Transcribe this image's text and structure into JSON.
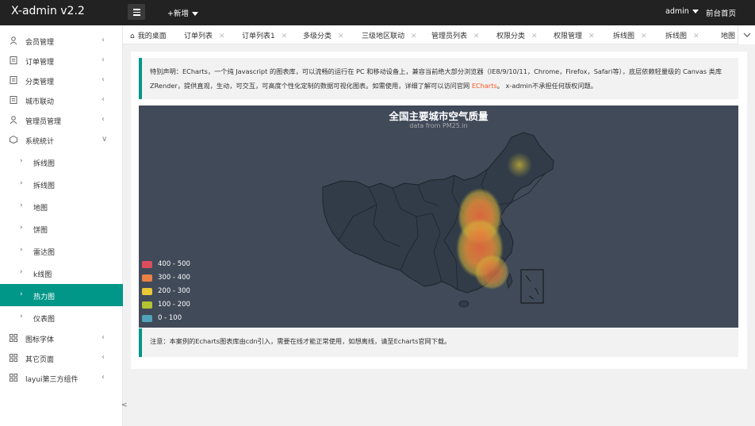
{
  "app": {
    "title": "X-admin v2.2"
  },
  "header": {
    "add_label": "+新增",
    "user_label": "admin",
    "front_label": "前台首页"
  },
  "sidebar": {
    "items": [
      {
        "label": "会员管理",
        "icon": "user-icon"
      },
      {
        "label": "订单管理",
        "icon": "doc-icon"
      },
      {
        "label": "分类管理",
        "icon": "doc-icon"
      },
      {
        "label": "城市联动",
        "icon": "doc-icon"
      },
      {
        "label": "管理员管理",
        "icon": "user-icon"
      },
      {
        "label": "系统统计",
        "icon": "stats-icon"
      }
    ],
    "sub_items": [
      {
        "label": "拆线图"
      },
      {
        "label": "拆线图"
      },
      {
        "label": "地图"
      },
      {
        "label": "饼图"
      },
      {
        "label": "雷达图"
      },
      {
        "label": "k线图"
      },
      {
        "label": "热力图",
        "active": true
      },
      {
        "label": "仪表图"
      }
    ],
    "bottom_items": [
      {
        "label": "图标字体",
        "icon": "grid-icon"
      },
      {
        "label": "其它页面",
        "icon": "grid-icon"
      },
      {
        "label": "layui第三方组件",
        "icon": "grid-icon"
      }
    ]
  },
  "tabs": [
    {
      "label": "我的桌面",
      "home": true
    },
    {
      "label": "订单列表"
    },
    {
      "label": "订单列表1"
    },
    {
      "label": "多级分类"
    },
    {
      "label": "三级地区联动"
    },
    {
      "label": "管理员列表"
    },
    {
      "label": "权限分类"
    },
    {
      "label": "权限管理"
    },
    {
      "label": "拆线图"
    },
    {
      "label": "拆线图"
    },
    {
      "label": "地图"
    }
  ],
  "notice": {
    "text_before": "特别声明：ECharts，一个纯 Javascript 的图表库，可以流畅的运行在 PC 和移动设备上，兼容当前绝大部分浏览器（IE8/9/10/11，Chrome，Firefox，Safari等），底层依赖轻量级的 Canvas 类库 ZRender，提供直观，生动，可交互，可高度个性化定制的数据可视化图表。如需使用，详细了解可以访问官网",
    "link": "ECharts",
    "text_after": "。 x-admin不承担任何版权问题。"
  },
  "chart_data": {
    "type": "heatmap",
    "title": "全国主要城市空气质量",
    "subtitle": "data from PM25.in",
    "background": "#404a59",
    "legend": [
      {
        "label": "400 - 500",
        "color": "#d94e5d"
      },
      {
        "label": "300 - 400",
        "color": "#eb8146"
      },
      {
        "label": "200 - 300",
        "color": "#eac736"
      },
      {
        "label": "100 - 200",
        "color": "#b5c334"
      },
      {
        "label": "0 - 100",
        "color": "#50a3ba"
      }
    ]
  },
  "footer_notice": {
    "text": "注意：本案例的Echarts图表库由cdn引入，需要在线才能正常使用，如想离线，请至Echarts官网下载。"
  }
}
